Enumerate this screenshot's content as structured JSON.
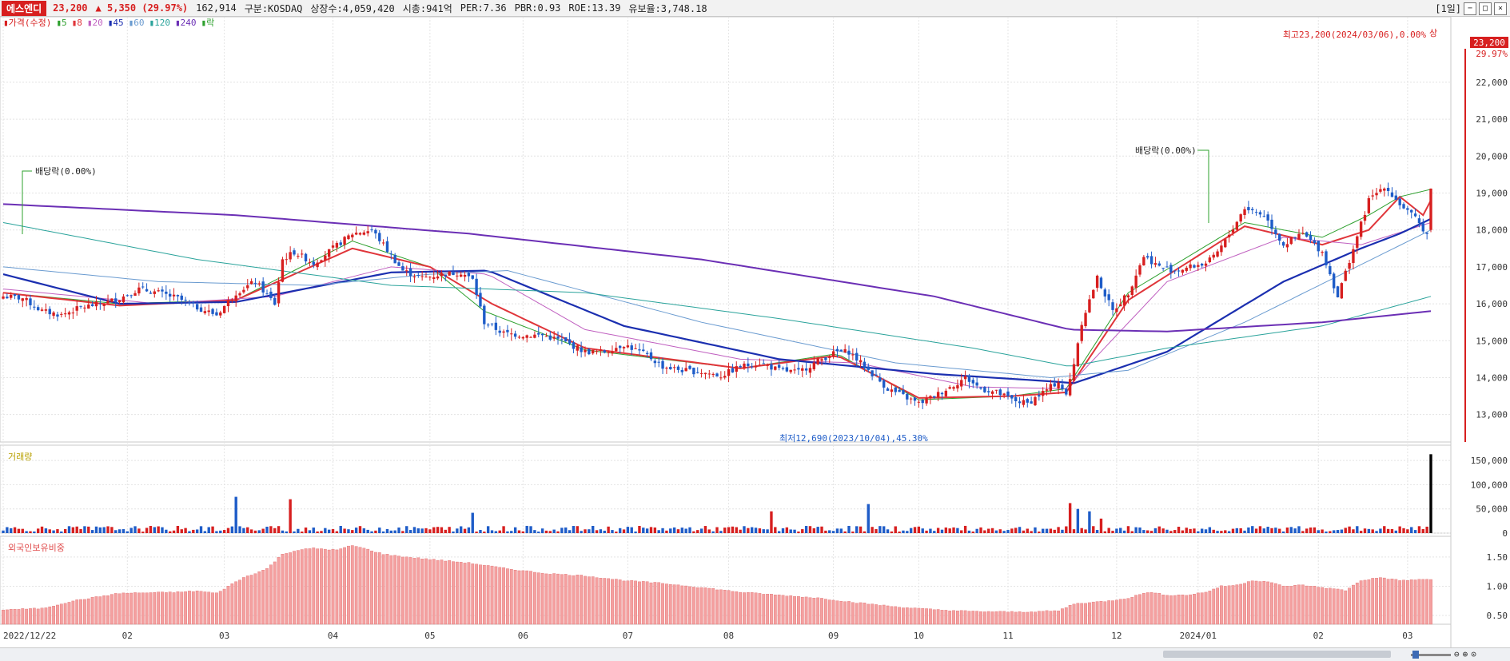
{
  "header": {
    "stock_name": "에스엔디",
    "price": "23,200",
    "change": "5,350",
    "change_pct": "(29.97%)",
    "volume": "162,914",
    "market": "구분:KOSDAQ",
    "listed_shares": "상장수:4,059,420",
    "market_cap": "시총:941억",
    "per": "PER:7.36",
    "pbr": "PBR:0.93",
    "roe": "ROE:13.39",
    "reserve": "유보율:3,748.18",
    "period": "[1일]",
    "up_icon": "up-arrow-icon"
  },
  "colors": {
    "up": "#d71f1f",
    "down": "#1e5cc8",
    "ma5": "#2ea02e",
    "ma20": "#d71f1f",
    "ma45": "#1b2fb0",
    "ma60": "#b56dbd",
    "ma120": "#2aa39b",
    "ma240": "#6b2fb5",
    "foreign_bar": "#f4a0a0",
    "grid": "#e4e4e4"
  },
  "chart_data": [
    {
      "type": "candlestick",
      "panel": "price",
      "legend": [
        {
          "label": "가격(수정)",
          "color": "#d71f1f"
        },
        {
          "label": "5",
          "color": "#2ea02e"
        },
        {
          "label": "8",
          "color": "#e0353a"
        },
        {
          "label": "20",
          "color": "#c060c0"
        },
        {
          "label": "45",
          "color": "#1b2fb0"
        },
        {
          "label": "60",
          "color": "#6a9bd0"
        },
        {
          "label": "120",
          "color": "#2aa39b"
        },
        {
          "label": "240",
          "color": "#6b2fb5"
        },
        {
          "label": "락",
          "color": "#2ea02e"
        }
      ],
      "ylim": [
        12300,
        23600
      ],
      "y_ticks": [
        13000,
        14000,
        15000,
        16000,
        17000,
        18000,
        19000,
        20000,
        21000,
        22000
      ],
      "y_tick_labels": [
        "13,000",
        "14,000",
        "15,000",
        "16,000",
        "17,000",
        "18,000",
        "19,000",
        "20,000",
        "21,000",
        "22,000"
      ],
      "last_price_label": "23,200",
      "last_pct_label": "29.97%",
      "annotations": {
        "high_label": "최고23,200(2024/03/06),0.00%",
        "high_marker": "상",
        "low_label": "최저12,690(2023/10/04),45.30%",
        "dividend_1": "배당락(0.00%)",
        "dividend_2": "배당락(0.00%)"
      },
      "price_path": [
        [
          0,
          16200
        ],
        [
          5,
          16150
        ],
        [
          10,
          15800
        ],
        [
          15,
          15700
        ],
        [
          20,
          15900
        ],
        [
          25,
          16000
        ],
        [
          30,
          16150
        ],
        [
          35,
          16400
        ],
        [
          40,
          16300
        ],
        [
          45,
          16150
        ],
        [
          50,
          15900
        ],
        [
          55,
          15700
        ],
        [
          60,
          16300
        ],
        [
          65,
          16600
        ],
        [
          70,
          16000
        ],
        [
          72,
          17200
        ],
        [
          75,
          17400
        ],
        [
          80,
          17100
        ],
        [
          85,
          17500
        ],
        [
          90,
          17900
        ],
        [
          95,
          18000
        ],
        [
          98,
          17600
        ],
        [
          100,
          17300
        ],
        [
          103,
          16900
        ],
        [
          108,
          16700
        ],
        [
          113,
          16800
        ],
        [
          118,
          16850
        ],
        [
          121,
          16650
        ],
        [
          124,
          15500
        ],
        [
          129,
          15200
        ],
        [
          134,
          15150
        ],
        [
          139,
          15150
        ],
        [
          144,
          15000
        ],
        [
          150,
          14700
        ],
        [
          155,
          14700
        ],
        [
          160,
          14900
        ],
        [
          166,
          14600
        ],
        [
          170,
          14300
        ],
        [
          175,
          14200
        ],
        [
          180,
          14150
        ],
        [
          185,
          14050
        ],
        [
          190,
          14300
        ],
        [
          195,
          14400
        ],
        [
          200,
          14200
        ],
        [
          205,
          14150
        ],
        [
          210,
          14450
        ],
        [
          215,
          14700
        ],
        [
          218,
          14700
        ],
        [
          222,
          14300
        ],
        [
          225,
          14000
        ],
        [
          228,
          13700
        ],
        [
          232,
          13500
        ],
        [
          236,
          13300
        ],
        [
          240,
          13500
        ],
        [
          245,
          13800
        ],
        [
          248,
          14000
        ],
        [
          252,
          13700
        ],
        [
          256,
          13600
        ],
        [
          260,
          13400
        ],
        [
          264,
          13300
        ],
        [
          268,
          13600
        ],
        [
          272,
          13900
        ],
        [
          274,
          13500
        ],
        [
          276,
          14400
        ],
        [
          278,
          15500
        ],
        [
          282,
          16700
        ],
        [
          286,
          15800
        ],
        [
          290,
          16300
        ],
        [
          294,
          17300
        ],
        [
          298,
          17000
        ],
        [
          302,
          16900
        ],
        [
          306,
          17000
        ],
        [
          310,
          17100
        ],
        [
          312,
          17250
        ],
        [
          315,
          17700
        ],
        [
          320,
          18600
        ],
        [
          325,
          18400
        ],
        [
          330,
          17600
        ],
        [
          335,
          17900
        ],
        [
          340,
          17400
        ],
        [
          344,
          16200
        ],
        [
          348,
          17500
        ],
        [
          352,
          18800
        ],
        [
          356,
          19200
        ],
        [
          360,
          18700
        ],
        [
          364,
          18300
        ],
        [
          367,
          17900
        ],
        [
          368,
          19100
        ]
      ],
      "ma_series": [
        {
          "name": "5",
          "path": [
            [
              0,
              16300
            ],
            [
              30,
              16000
            ],
            [
              60,
              16100
            ],
            [
              90,
              17700
            ],
            [
              110,
              17000
            ],
            [
              124,
              15800
            ],
            [
              150,
              14750
            ],
            [
              190,
              14250
            ],
            [
              215,
              14650
            ],
            [
              236,
              13400
            ],
            [
              260,
              13500
            ],
            [
              274,
              13700
            ],
            [
              290,
              16300
            ],
            [
              320,
              18200
            ],
            [
              340,
              17800
            ],
            [
              352,
              18400
            ],
            [
              360,
              18900
            ],
            [
              368,
              19100
            ]
          ]
        },
        {
          "name": "8",
          "path": [
            [
              0,
              16300
            ],
            [
              30,
              15950
            ],
            [
              60,
              16100
            ],
            [
              90,
              17500
            ],
            [
              110,
              17000
            ],
            [
              126,
              16000
            ],
            [
              150,
              14800
            ],
            [
              190,
              14250
            ],
            [
              215,
              14600
            ],
            [
              236,
              13450
            ],
            [
              260,
              13500
            ],
            [
              274,
              13600
            ],
            [
              290,
              16100
            ],
            [
              320,
              18100
            ],
            [
              340,
              17600
            ],
            [
              352,
              18000
            ],
            [
              360,
              18900
            ],
            [
              366,
              18400
            ],
            [
              368,
              18800
            ]
          ]
        },
        {
          "name": "20",
          "path": [
            [
              0,
              16400
            ],
            [
              40,
              16000
            ],
            [
              70,
              16200
            ],
            [
              100,
              17000
            ],
            [
              125,
              16800
            ],
            [
              150,
              15300
            ],
            [
              190,
              14500
            ],
            [
              220,
              14400
            ],
            [
              250,
              13750
            ],
            [
              274,
              13700
            ],
            [
              300,
              16600
            ],
            [
              330,
              17800
            ],
            [
              350,
              17600
            ],
            [
              368,
              18200
            ]
          ]
        },
        {
          "name": "45",
          "path": [
            [
              0,
              16800
            ],
            [
              30,
              16000
            ],
            [
              60,
              16050
            ],
            [
              100,
              16850
            ],
            [
              125,
              16900
            ],
            [
              160,
              15400
            ],
            [
              200,
              14500
            ],
            [
              240,
              14100
            ],
            [
              270,
              13900
            ],
            [
              276,
              13850
            ],
            [
              300,
              14700
            ],
            [
              330,
              16600
            ],
            [
              350,
              17500
            ],
            [
              360,
              17900
            ],
            [
              368,
              18300
            ]
          ]
        },
        {
          "name": "60",
          "path": [
            [
              0,
              17000
            ],
            [
              40,
              16600
            ],
            [
              80,
              16500
            ],
            [
              110,
              16800
            ],
            [
              130,
              16900
            ],
            [
              180,
              15500
            ],
            [
              230,
              14400
            ],
            [
              270,
              14000
            ],
            [
              290,
              14200
            ],
            [
              320,
              15500
            ],
            [
              345,
              16800
            ],
            [
              368,
              18000
            ]
          ]
        },
        {
          "name": "120",
          "path": [
            [
              0,
              18200
            ],
            [
              50,
              17200
            ],
            [
              100,
              16500
            ],
            [
              150,
              16300
            ],
            [
              200,
              15600
            ],
            [
              250,
              14800
            ],
            [
              275,
              14300
            ],
            [
              300,
              14800
            ],
            [
              340,
              15400
            ],
            [
              368,
              16200
            ]
          ]
        },
        {
          "name": "240",
          "path": [
            [
              0,
              18700
            ],
            [
              60,
              18400
            ],
            [
              120,
              17900
            ],
            [
              180,
              17200
            ],
            [
              240,
              16200
            ],
            [
              275,
              15300
            ],
            [
              300,
              15250
            ],
            [
              340,
              15500
            ],
            [
              368,
              15800
            ]
          ]
        }
      ]
    },
    {
      "type": "bar",
      "panel": "volume",
      "title": "거래량",
      "ylim": [
        0,
        175000
      ],
      "y_ticks": [
        0,
        50000,
        100000,
        150000
      ],
      "y_tick_labels": [
        "0",
        "50,000",
        "100,000",
        "150,000"
      ],
      "last_value": 162914,
      "spikes": [
        [
          60,
          75000
        ],
        [
          74,
          70000
        ],
        [
          121,
          42000
        ],
        [
          198,
          45000
        ],
        [
          223,
          60000
        ],
        [
          275,
          62000
        ],
        [
          277,
          50000
        ],
        [
          280,
          45000
        ],
        [
          283,
          30000
        ]
      ]
    },
    {
      "type": "bar",
      "panel": "foreign",
      "title": "외국인보유비중",
      "ylim": [
        0.35,
        1.8
      ],
      "y_ticks": [
        0.5,
        1.0,
        1.5
      ],
      "y_tick_labels": [
        "0.50",
        "1.00",
        "1.50"
      ],
      "path": [
        [
          0,
          0.6
        ],
        [
          10,
          0.62
        ],
        [
          18,
          0.75
        ],
        [
          30,
          0.88
        ],
        [
          45,
          0.9
        ],
        [
          50,
          0.92
        ],
        [
          55,
          0.88
        ],
        [
          58,
          1.0
        ],
        [
          62,
          1.15
        ],
        [
          68,
          1.3
        ],
        [
          72,
          1.55
        ],
        [
          76,
          1.62
        ],
        [
          80,
          1.65
        ],
        [
          86,
          1.62
        ],
        [
          90,
          1.7
        ],
        [
          94,
          1.63
        ],
        [
          98,
          1.55
        ],
        [
          104,
          1.5
        ],
        [
          112,
          1.45
        ],
        [
          120,
          1.4
        ],
        [
          130,
          1.3
        ],
        [
          140,
          1.22
        ],
        [
          150,
          1.18
        ],
        [
          160,
          1.1
        ],
        [
          170,
          1.05
        ],
        [
          180,
          0.98
        ],
        [
          190,
          0.9
        ],
        [
          200,
          0.85
        ],
        [
          210,
          0.8
        ],
        [
          220,
          0.72
        ],
        [
          230,
          0.65
        ],
        [
          240,
          0.6
        ],
        [
          250,
          0.57
        ],
        [
          262,
          0.56
        ],
        [
          272,
          0.58
        ],
        [
          276,
          0.7
        ],
        [
          285,
          0.75
        ],
        [
          290,
          0.8
        ],
        [
          295,
          0.9
        ],
        [
          300,
          0.85
        ],
        [
          305,
          0.85
        ],
        [
          310,
          0.9
        ],
        [
          314,
          1.0
        ],
        [
          318,
          1.02
        ],
        [
          322,
          1.1
        ],
        [
          326,
          1.08
        ],
        [
          330,
          1.0
        ],
        [
          335,
          1.02
        ],
        [
          340,
          0.98
        ],
        [
          346,
          0.93
        ],
        [
          350,
          1.1
        ],
        [
          355,
          1.15
        ],
        [
          360,
          1.1
        ],
        [
          368,
          1.12
        ]
      ]
    }
  ],
  "x_axis": {
    "labels": [
      {
        "text": "2022/12/22",
        "i": 0
      },
      {
        "text": "02",
        "i": 32
      },
      {
        "text": "03",
        "i": 57
      },
      {
        "text": "04",
        "i": 85
      },
      {
        "text": "05",
        "i": 110
      },
      {
        "text": "06",
        "i": 134
      },
      {
        "text": "07",
        "i": 161
      },
      {
        "text": "08",
        "i": 187
      },
      {
        "text": "09",
        "i": 214
      },
      {
        "text": "10",
        "i": 236
      },
      {
        "text": "11",
        "i": 259
      },
      {
        "text": "12",
        "i": 287
      },
      {
        "text": "2024/01",
        "i": 308
      },
      {
        "text": "02",
        "i": 339
      },
      {
        "text": "03",
        "i": 362
      }
    ]
  },
  "footer": {
    "zoom_icons": [
      "zoom-out-icon",
      "zoom-in-icon",
      "zoom-reset-icon"
    ]
  }
}
